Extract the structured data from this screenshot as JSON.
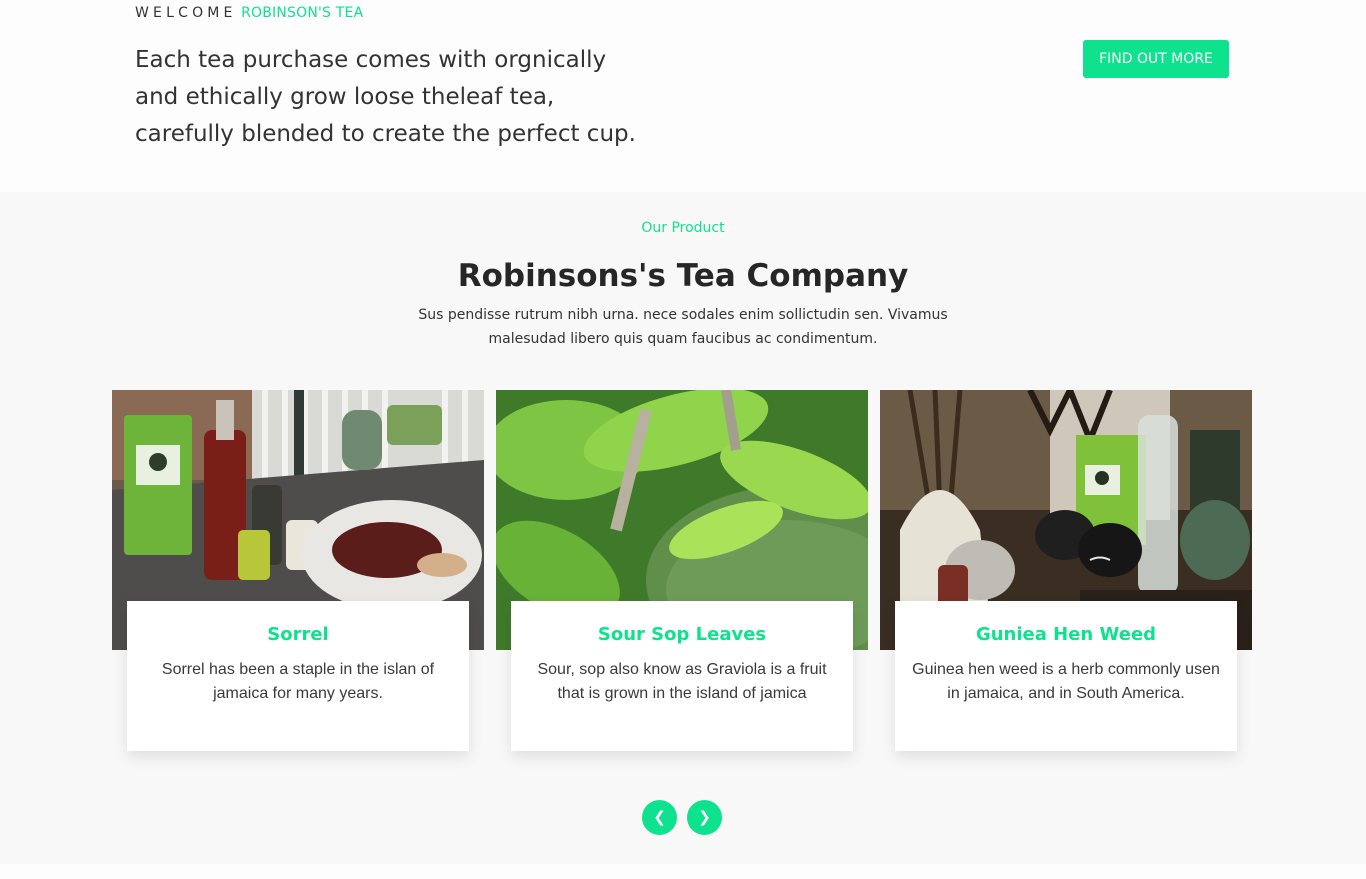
{
  "header": {
    "welcome_word": "WELCOME",
    "brand_name": "ROBINSON'S TEA",
    "intro": "Each tea purchase comes with orgnically and ethically grow loose theleaf tea, carefully blended to create the perfect cup.",
    "cta_label": "FIND OUT MORE"
  },
  "products": {
    "eyebrow": "Our Product",
    "title": "Robinsons's Tea Company",
    "description": "Sus pendisse rutrum nibh urna. nece sodales enim sollictudin sen. Vivamus malesudad libero quis quam faucibus ac condimentum.",
    "cards": [
      {
        "title": "Sorrel",
        "text": "Sorrel has been a staple in the islan of jamaica for many years.",
        "photo_icon": "tea-table-photo"
      },
      {
        "title": "Sour Sop Leaves",
        "text": "Sour, sop also know as Graviola is a fruit that is grown in the island of jamica",
        "photo_icon": "soursop-leaves-photo"
      },
      {
        "title": "Guniea Hen Weed",
        "text": "Guinea hen weed is a herb commonly usen in jamaica, and in South America.",
        "photo_icon": "tea-set-photo"
      }
    ],
    "prev_icon": "chevron-left-icon",
    "next_icon": "chevron-right-icon",
    "prev_glyph": "❮",
    "next_glyph": "❯"
  },
  "colors": {
    "accent": "#0fe28e",
    "page_background": "#fdfdfd",
    "section_background": "#f8f8f8",
    "text": "#212529"
  }
}
